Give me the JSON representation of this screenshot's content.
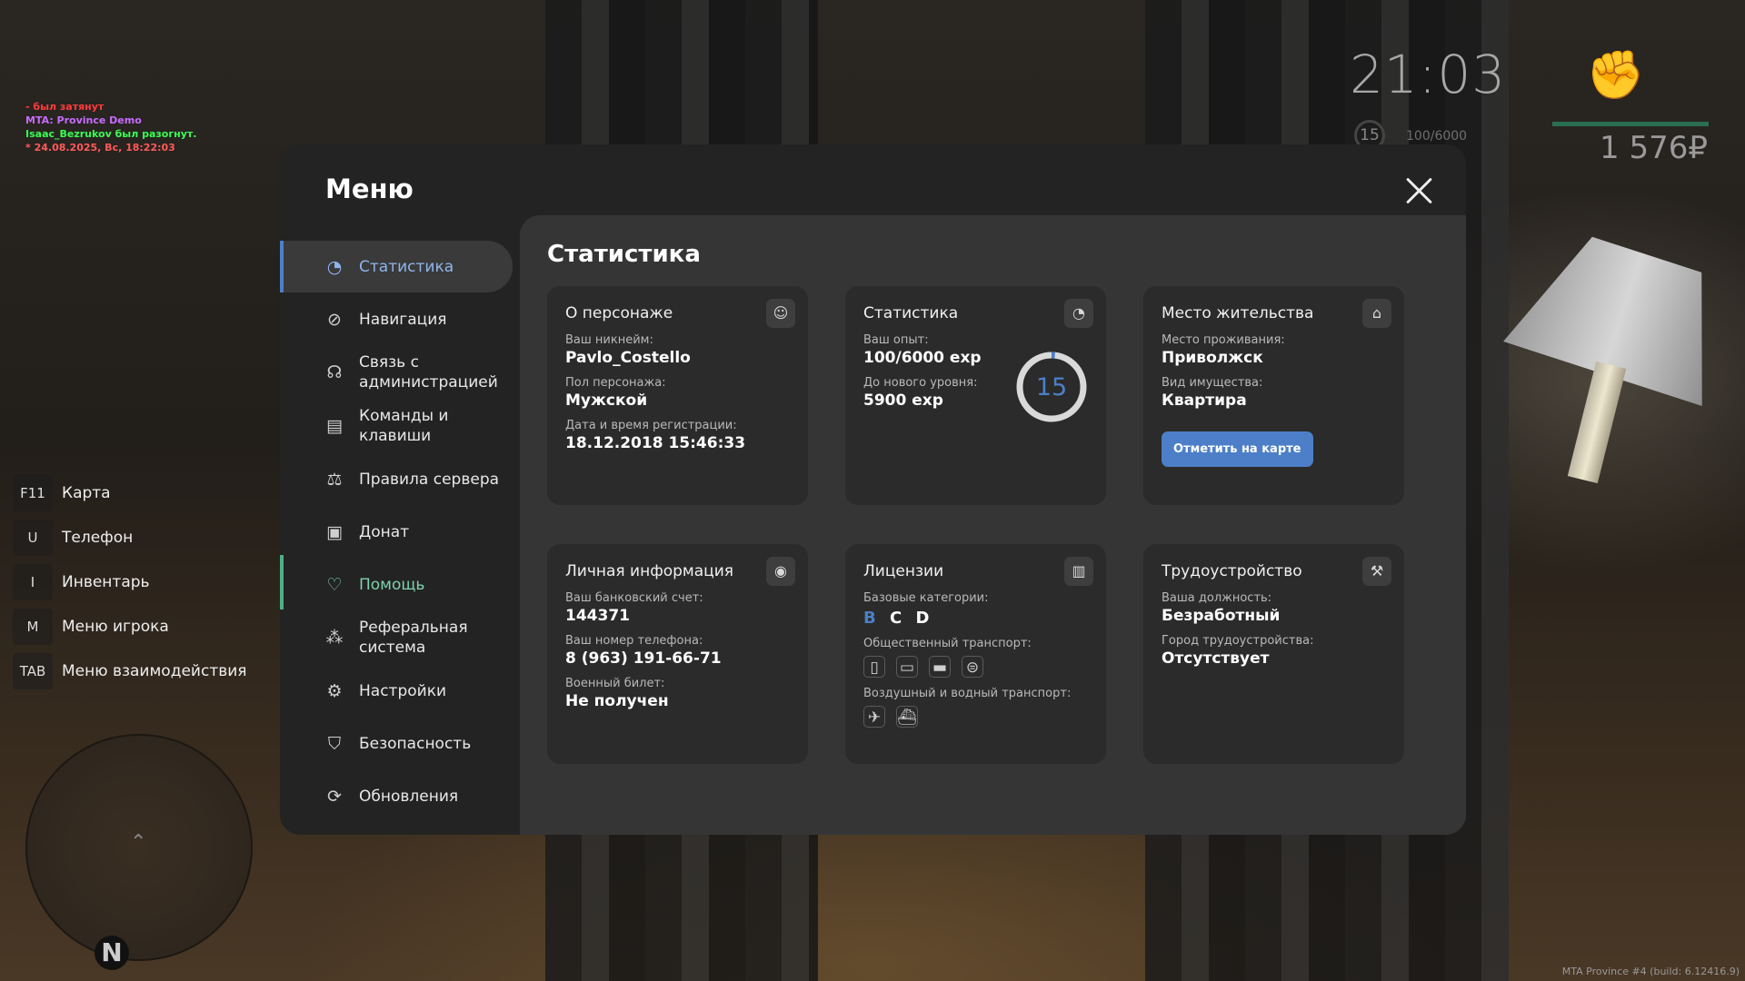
{
  "chat": [
    {
      "text": "- был затянут",
      "color": "#ff3b3b"
    },
    {
      "text": "MTA: Province Demo",
      "color": "#c96bff"
    },
    {
      "text": "Isaac_Bezrukov был разогнут.",
      "color": "#39ff52"
    },
    {
      "text": "* 24.08.2025, Вс, 18:22:03",
      "color": "#ff5a5a"
    }
  ],
  "hud": {
    "clock": "21:03",
    "level": "15",
    "exp": "100/6000",
    "money": "1 576₽",
    "fist_icon": "fist-icon"
  },
  "hotkeys": [
    {
      "key": "F11",
      "label": "Карта"
    },
    {
      "key": "U",
      "label": "Телефон"
    },
    {
      "key": "I",
      "label": "Инвентарь"
    },
    {
      "key": "M",
      "label": "Меню игрока"
    },
    {
      "key": "TAB",
      "label": "Меню взаимодействия"
    }
  ],
  "minimap": {
    "north": "N"
  },
  "build": "MTA Province #4 (build: 6.12416.9)",
  "menu": {
    "title": "Меню",
    "nav": [
      {
        "label": "Статистика",
        "icon": "chart-icon"
      },
      {
        "label": "Навигация",
        "icon": "compass-icon"
      },
      {
        "label": "Связь с администрацией",
        "icon": "headset-icon"
      },
      {
        "label": "Команды и клавиши",
        "icon": "document-icon"
      },
      {
        "label": "Правила сервера",
        "icon": "scales-icon"
      },
      {
        "label": "Донат",
        "icon": "wallet-icon"
      },
      {
        "label": "Помощь",
        "icon": "heart-hands-icon"
      },
      {
        "label": "Реферальная система",
        "icon": "referral-icon"
      },
      {
        "label": "Настройки",
        "icon": "gear-icon"
      },
      {
        "label": "Безопасность",
        "icon": "shield-icon"
      },
      {
        "label": "Обновления",
        "icon": "update-icon"
      }
    ],
    "active_tab": "Статистика"
  },
  "content": {
    "title": "Статистика",
    "character": {
      "title": "О персонаже",
      "nick_label": "Ваш никнейм:",
      "nick": "Pavlo_Costello",
      "gender_label": "Пол персонажа:",
      "gender": "Мужской",
      "reg_label": "Дата и время регистрации:",
      "reg": "18.12.2018 15:46:33"
    },
    "stats": {
      "title": "Статистика",
      "exp_label": "Ваш опыт:",
      "exp": "100/6000 exp",
      "next_label": "До нового уровня:",
      "next": "5900 exp",
      "level": "15",
      "level_progress": 0.0167
    },
    "residence": {
      "title": "Место жительства",
      "place_label": "Место проживания:",
      "place": "Приволжск",
      "property_label": "Вид имущества:",
      "property": "Квартира",
      "map_button": "Отметить на карте"
    },
    "personal": {
      "title": "Личная информация",
      "bank_label": "Ваш банковский счет:",
      "bank": "144371",
      "phone_label": "Ваш номер телефона:",
      "phone": "8 (963) 191-66-71",
      "military_label": "Военный билет:",
      "military": "Не получен"
    },
    "licenses": {
      "title": "Лицензии",
      "basic_label": "Базовые категории:",
      "categories": [
        "B",
        "C",
        "D"
      ],
      "public_label": "Общественный транспорт:",
      "air_label": "Воздушный и водный транспорт:"
    },
    "employment": {
      "title": "Трудоустройство",
      "position_label": "Ваша должность:",
      "position": "Безработный",
      "city_label": "Город трудоустройства:",
      "city": "Отсутствует"
    }
  }
}
